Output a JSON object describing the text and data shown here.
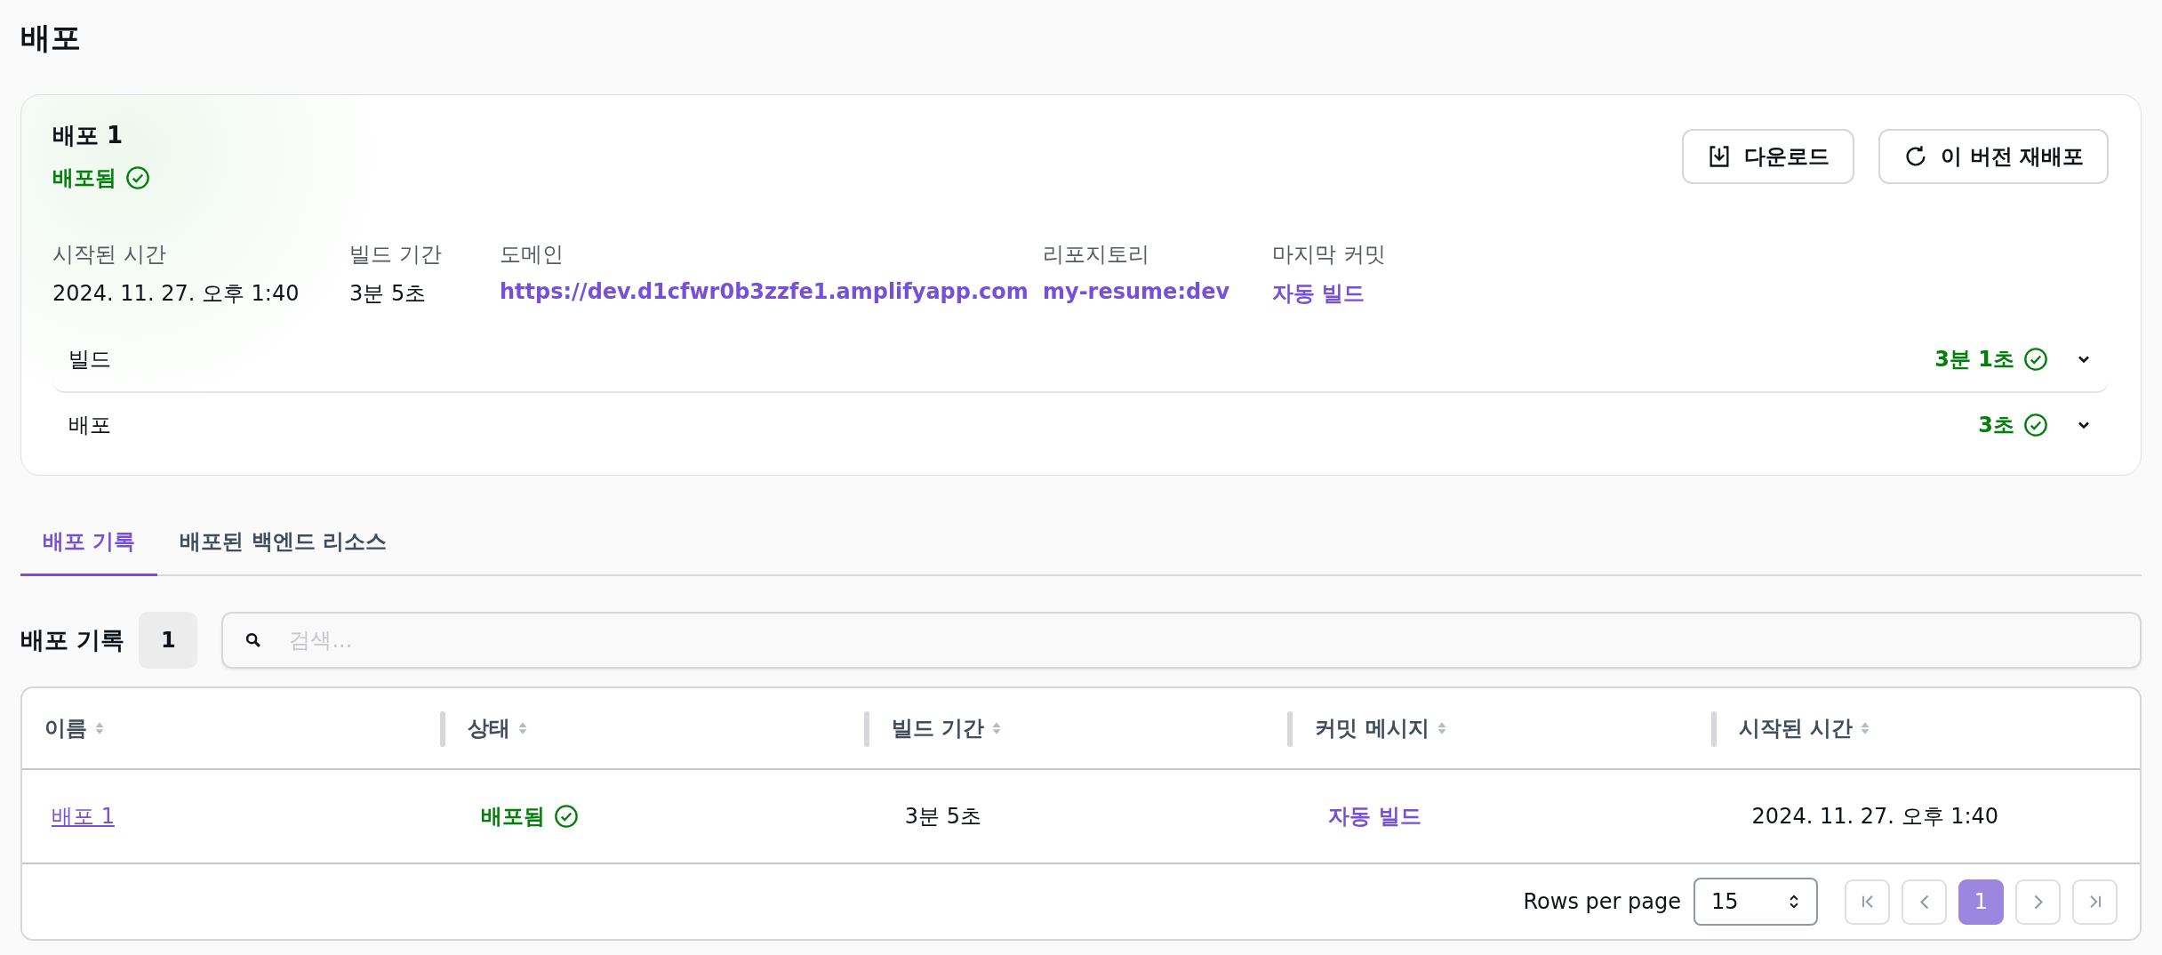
{
  "page_title": "배포",
  "deployment": {
    "title": "배포 1",
    "status": {
      "label": "배포됨",
      "kind": "success"
    },
    "buttons": [
      {
        "label": "다운로드",
        "kind": "download"
      },
      {
        "label": "이 버전 재배포",
        "kind": "redeploy"
      }
    ],
    "fields": [
      {
        "label": "시작된 시간",
        "value": "2024. 11. 27. 오후 1:40",
        "link": false
      },
      {
        "label": "빌드 기간",
        "value": "3분 5초",
        "link": false
      },
      {
        "label": "도메인",
        "value": "https://dev.d1cfwr0b3zzfe1.amplifyapp.com",
        "link": true
      },
      {
        "label": "리포지토리",
        "value": "my-resume:dev",
        "link": true
      },
      {
        "label": "마지막 커밋",
        "value": "자동 빌드",
        "link": true
      }
    ],
    "steps": [
      {
        "name": "빌드",
        "duration": "3분 1초",
        "expanded": false
      },
      {
        "name": "배포",
        "duration": "3초",
        "expanded": false
      }
    ]
  },
  "tabs": [
    {
      "label": "배포 기록",
      "selected": true
    },
    {
      "label": "배포된 백엔드 리소스",
      "selected": false
    }
  ],
  "history": {
    "title": "배포 기록",
    "count": "1",
    "search": {
      "placeholder": "검색..."
    },
    "columns": [
      "이름",
      "상태",
      "빌드 기간",
      "커밋 메시지",
      "시작된 시간"
    ],
    "rows": [
      {
        "name": "배포 1",
        "status": "배포됨",
        "build_duration": "3분 5초",
        "commit_message": "자동 빌드",
        "started": "2024. 11. 27. 오후 1:40"
      }
    ],
    "pagination": {
      "rows_per_page_label": "Rows per page",
      "rows_per_page": "15",
      "pages": [
        {
          "label": "1",
          "selected": true
        }
      ]
    }
  }
}
